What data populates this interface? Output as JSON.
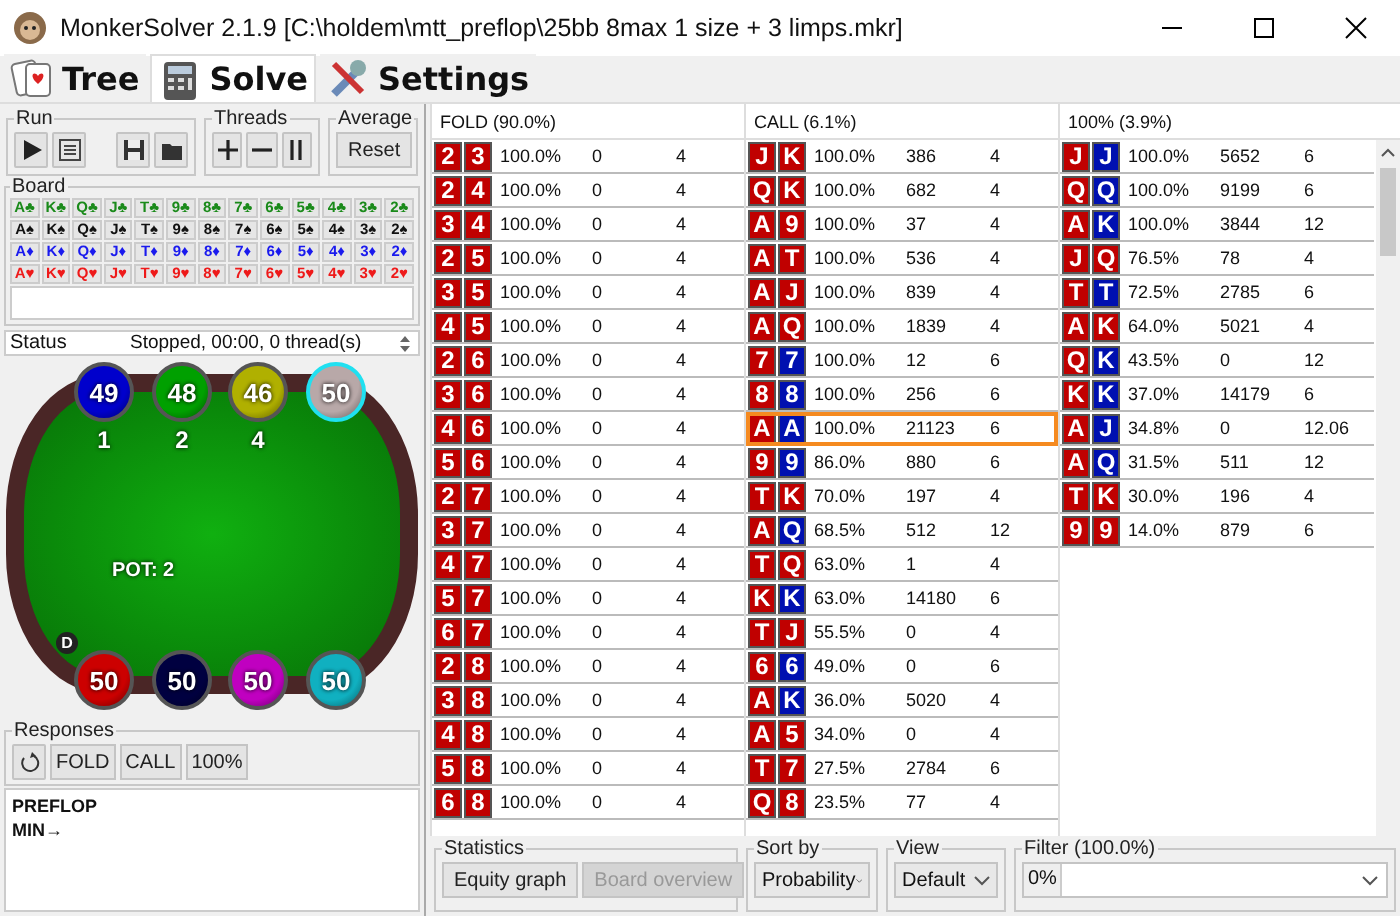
{
  "window": {
    "title": "MonkerSolver 2.1.9 [C:\\holdem\\mtt_preflop\\25bb 8max 1 size  + 3 limps.mkr]"
  },
  "tabs": [
    {
      "label": "Tree",
      "kind": "tree",
      "selected": false
    },
    {
      "label": "Solve",
      "kind": "solve",
      "selected": true
    },
    {
      "label": "Settings",
      "kind": "settings",
      "selected": false
    }
  ],
  "run": {
    "label": "Run"
  },
  "threads": {
    "label": "Threads"
  },
  "average": {
    "label": "Average",
    "button": "Reset"
  },
  "board": {
    "label": "Board",
    "rows": [
      {
        "color": "#1a8a1a",
        "cards": [
          "A♣",
          "K♣",
          "Q♣",
          "J♣",
          "T♣",
          "9♣",
          "8♣",
          "7♣",
          "6♣",
          "5♣",
          "4♣",
          "3♣",
          "2♣"
        ]
      },
      {
        "color": "#111111",
        "cards": [
          "A♠",
          "K♠",
          "Q♠",
          "J♠",
          "T♠",
          "9♠",
          "8♠",
          "7♠",
          "6♠",
          "5♠",
          "4♠",
          "3♠",
          "2♠"
        ]
      },
      {
        "color": "#1a1aee",
        "cards": [
          "A♦",
          "K♦",
          "Q♦",
          "J♦",
          "T♦",
          "9♦",
          "8♦",
          "7♦",
          "6♦",
          "5♦",
          "4♦",
          "3♦",
          "2♦"
        ]
      },
      {
        "color": "#ee1a1a",
        "cards": [
          "A♥",
          "K♥",
          "Q♥",
          "J♥",
          "T♥",
          "9♥",
          "8♥",
          "7♥",
          "6♥",
          "5♥",
          "4♥",
          "3♥",
          "2♥"
        ]
      }
    ]
  },
  "status": {
    "label": "Status",
    "text": "Stopped, 00:00, 0 thread(s)"
  },
  "poker_table": {
    "pot": "POT: 2",
    "top_seats": [
      {
        "stack": "49",
        "color": "#0000cc",
        "bet": "1",
        "active": false
      },
      {
        "stack": "48",
        "color": "#00a000",
        "bet": "2",
        "active": false
      },
      {
        "stack": "46",
        "color": "#b0b000",
        "bet": "4",
        "active": false
      },
      {
        "stack": "50",
        "color": "#b8a8a8",
        "active": true
      }
    ],
    "bottom_seats": [
      {
        "stack": "50",
        "color": "#cc0000",
        "dealer": "D",
        "active": false
      },
      {
        "stack": "50",
        "color": "#000040",
        "active": false
      },
      {
        "stack": "50",
        "color": "#c000c0",
        "active": false
      },
      {
        "stack": "50",
        "color": "#10b0c0",
        "active": false
      }
    ]
  },
  "responses": {
    "label": "Responses",
    "buttons": [
      "FOLD",
      "CALL",
      "100%"
    ],
    "lines": [
      "PREFLOP",
      "MIN→"
    ]
  },
  "columns": [
    {
      "title": "FOLD (90.0%)",
      "rows": [
        {
          "hand": [
            "2",
            "3"
          ],
          "suited": true,
          "frequency": "100.0%",
          "count": "0",
          "value": "4",
          "highlighted": false
        },
        {
          "hand": [
            "2",
            "4"
          ],
          "suited": true,
          "frequency": "100.0%",
          "count": "0",
          "value": "4",
          "highlighted": false
        },
        {
          "hand": [
            "3",
            "4"
          ],
          "suited": true,
          "frequency": "100.0%",
          "count": "0",
          "value": "4",
          "highlighted": false
        },
        {
          "hand": [
            "2",
            "5"
          ],
          "suited": true,
          "frequency": "100.0%",
          "count": "0",
          "value": "4",
          "highlighted": false
        },
        {
          "hand": [
            "3",
            "5"
          ],
          "suited": true,
          "frequency": "100.0%",
          "count": "0",
          "value": "4",
          "highlighted": false
        },
        {
          "hand": [
            "4",
            "5"
          ],
          "suited": true,
          "frequency": "100.0%",
          "count": "0",
          "value": "4",
          "highlighted": false
        },
        {
          "hand": [
            "2",
            "6"
          ],
          "suited": true,
          "frequency": "100.0%",
          "count": "0",
          "value": "4",
          "highlighted": false
        },
        {
          "hand": [
            "3",
            "6"
          ],
          "suited": true,
          "frequency": "100.0%",
          "count": "0",
          "value": "4",
          "highlighted": false
        },
        {
          "hand": [
            "4",
            "6"
          ],
          "suited": true,
          "frequency": "100.0%",
          "count": "0",
          "value": "4",
          "highlighted": false
        },
        {
          "hand": [
            "5",
            "6"
          ],
          "suited": true,
          "frequency": "100.0%",
          "count": "0",
          "value": "4",
          "highlighted": false
        },
        {
          "hand": [
            "2",
            "7"
          ],
          "suited": true,
          "frequency": "100.0%",
          "count": "0",
          "value": "4",
          "highlighted": false
        },
        {
          "hand": [
            "3",
            "7"
          ],
          "suited": true,
          "frequency": "100.0%",
          "count": "0",
          "value": "4",
          "highlighted": false
        },
        {
          "hand": [
            "4",
            "7"
          ],
          "suited": true,
          "frequency": "100.0%",
          "count": "0",
          "value": "4",
          "highlighted": false
        },
        {
          "hand": [
            "5",
            "7"
          ],
          "suited": true,
          "frequency": "100.0%",
          "count": "0",
          "value": "4",
          "highlighted": false
        },
        {
          "hand": [
            "6",
            "7"
          ],
          "suited": true,
          "frequency": "100.0%",
          "count": "0",
          "value": "4",
          "highlighted": false
        },
        {
          "hand": [
            "2",
            "8"
          ],
          "suited": true,
          "frequency": "100.0%",
          "count": "0",
          "value": "4",
          "highlighted": false
        },
        {
          "hand": [
            "3",
            "8"
          ],
          "suited": true,
          "frequency": "100.0%",
          "count": "0",
          "value": "4",
          "highlighted": false
        },
        {
          "hand": [
            "4",
            "8"
          ],
          "suited": true,
          "frequency": "100.0%",
          "count": "0",
          "value": "4",
          "highlighted": false
        },
        {
          "hand": [
            "5",
            "8"
          ],
          "suited": true,
          "frequency": "100.0%",
          "count": "0",
          "value": "4",
          "highlighted": false
        },
        {
          "hand": [
            "6",
            "8"
          ],
          "suited": true,
          "frequency": "100.0%",
          "count": "0",
          "value": "4",
          "highlighted": false
        }
      ]
    },
    {
      "title": "CALL (6.1%)",
      "rows": [
        {
          "hand": [
            "J",
            "K"
          ],
          "suited": true,
          "frequency": "100.0%",
          "count": "386",
          "value": "4",
          "highlighted": false
        },
        {
          "hand": [
            "Q",
            "K"
          ],
          "suited": true,
          "frequency": "100.0%",
          "count": "682",
          "value": "4",
          "highlighted": false
        },
        {
          "hand": [
            "A",
            "9"
          ],
          "suited": true,
          "frequency": "100.0%",
          "count": "37",
          "value": "4",
          "highlighted": false
        },
        {
          "hand": [
            "A",
            "T"
          ],
          "suited": true,
          "frequency": "100.0%",
          "count": "536",
          "value": "4",
          "highlighted": false
        },
        {
          "hand": [
            "A",
            "J"
          ],
          "suited": true,
          "frequency": "100.0%",
          "count": "839",
          "value": "4",
          "highlighted": false
        },
        {
          "hand": [
            "A",
            "Q"
          ],
          "suited": true,
          "frequency": "100.0%",
          "count": "1839",
          "value": "4",
          "highlighted": false
        },
        {
          "hand": [
            "7",
            "7"
          ],
          "suited": false,
          "frequency": "100.0%",
          "count": "12",
          "value": "6",
          "highlighted": false
        },
        {
          "hand": [
            "8",
            "8"
          ],
          "suited": false,
          "frequency": "100.0%",
          "count": "256",
          "value": "6",
          "highlighted": false
        },
        {
          "hand": [
            "A",
            "A"
          ],
          "suited": false,
          "frequency": "100.0%",
          "count": "21123",
          "value": "6",
          "highlighted": true
        },
        {
          "hand": [
            "9",
            "9"
          ],
          "suited": false,
          "frequency": "86.0%",
          "count": "880",
          "value": "6",
          "highlighted": false
        },
        {
          "hand": [
            "T",
            "K"
          ],
          "suited": true,
          "frequency": "70.0%",
          "count": "197",
          "value": "4",
          "highlighted": false
        },
        {
          "hand": [
            "A",
            "Q"
          ],
          "suited": false,
          "frequency": "68.5%",
          "count": "512",
          "value": "12",
          "highlighted": false
        },
        {
          "hand": [
            "T",
            "Q"
          ],
          "suited": true,
          "frequency": "63.0%",
          "count": "1",
          "value": "4",
          "highlighted": false
        },
        {
          "hand": [
            "K",
            "K"
          ],
          "suited": false,
          "frequency": "63.0%",
          "count": "14180",
          "value": "6",
          "highlighted": false
        },
        {
          "hand": [
            "T",
            "J"
          ],
          "suited": true,
          "frequency": "55.5%",
          "count": "0",
          "value": "4",
          "highlighted": false
        },
        {
          "hand": [
            "6",
            "6"
          ],
          "suited": false,
          "frequency": "49.0%",
          "count": "0",
          "value": "6",
          "highlighted": false
        },
        {
          "hand": [
            "A",
            "K"
          ],
          "suited": false,
          "frequency": "36.0%",
          "count": "5020",
          "value": "4",
          "highlighted": false
        },
        {
          "hand": [
            "A",
            "5"
          ],
          "suited": true,
          "frequency": "34.0%",
          "count": "0",
          "value": "4",
          "highlighted": false
        },
        {
          "hand": [
            "T",
            "7"
          ],
          "suited": true,
          "frequency": "27.5%",
          "count": "2784",
          "value": "6",
          "highlighted": false
        },
        {
          "hand": [
            "Q",
            "8"
          ],
          "suited": true,
          "frequency": "23.5%",
          "count": "77",
          "value": "4",
          "highlighted": false
        }
      ]
    },
    {
      "title": "100% (3.9%)",
      "rows": [
        {
          "hand": [
            "J",
            "J"
          ],
          "suited": false,
          "frequency": "100.0%",
          "count": "5652",
          "value": "6",
          "highlighted": false
        },
        {
          "hand": [
            "Q",
            "Q"
          ],
          "suited": false,
          "frequency": "100.0%",
          "count": "9199",
          "value": "6",
          "highlighted": false
        },
        {
          "hand": [
            "A",
            "K"
          ],
          "suited": false,
          "frequency": "100.0%",
          "count": "3844",
          "value": "12",
          "highlighted": false
        },
        {
          "hand": [
            "J",
            "Q"
          ],
          "suited": true,
          "frequency": "76.5%",
          "count": "78",
          "value": "4",
          "highlighted": false
        },
        {
          "hand": [
            "T",
            "T"
          ],
          "suited": false,
          "frequency": "72.5%",
          "count": "2785",
          "value": "6",
          "highlighted": false
        },
        {
          "hand": [
            "A",
            "K"
          ],
          "suited": true,
          "frequency": "64.0%",
          "count": "5021",
          "value": "4",
          "highlighted": false
        },
        {
          "hand": [
            "Q",
            "K"
          ],
          "suited": false,
          "frequency": "43.5%",
          "count": "0",
          "value": "12",
          "highlighted": false
        },
        {
          "hand": [
            "K",
            "K"
          ],
          "suited": false,
          "frequency": "37.0%",
          "count": "14179",
          "value": "6",
          "highlighted": false
        },
        {
          "hand": [
            "A",
            "J"
          ],
          "suited": false,
          "frequency": "34.8%",
          "count": "0",
          "value": "12.06",
          "highlighted": false
        },
        {
          "hand": [
            "A",
            "Q"
          ],
          "suited": false,
          "frequency": "31.5%",
          "count": "511",
          "value": "12",
          "highlighted": false
        },
        {
          "hand": [
            "T",
            "K"
          ],
          "suited": true,
          "frequency": "30.0%",
          "count": "196",
          "value": "4",
          "highlighted": false
        },
        {
          "hand": [
            "9",
            "9"
          ],
          "suited": true,
          "frequency": "14.0%",
          "count": "879",
          "value": "6",
          "highlighted": false
        }
      ]
    }
  ],
  "statistics": {
    "label": "Statistics",
    "buttons": [
      {
        "label": "Equity graph",
        "disabled": false
      },
      {
        "label": "Board overview",
        "disabled": true
      }
    ]
  },
  "sort_by": {
    "label": "Sort by",
    "value": "Probability"
  },
  "view": {
    "label": "View",
    "value": "Default"
  },
  "filter": {
    "label": "Filter (100.0%)",
    "prefix": "0%"
  }
}
